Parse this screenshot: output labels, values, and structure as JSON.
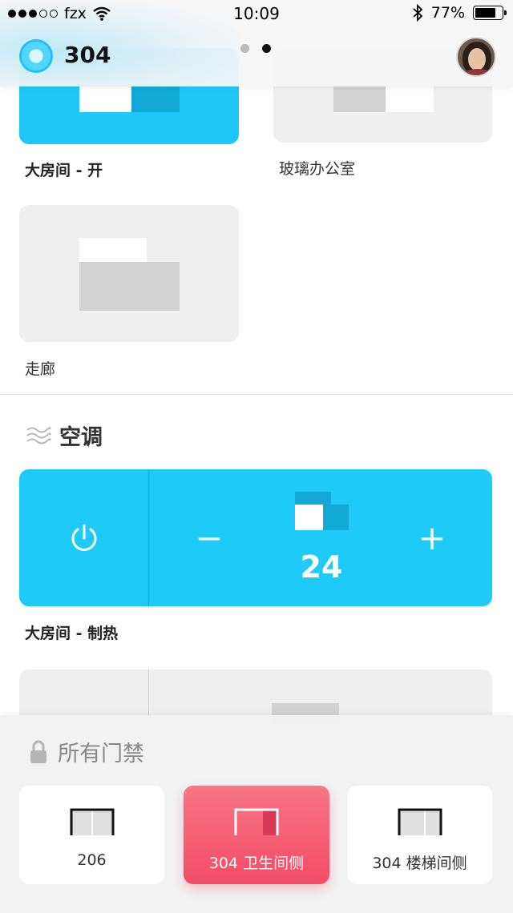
{
  "status_bar": {
    "carrier": "fzx",
    "time": "10:09",
    "battery": "77%",
    "battery_level": 0.77
  },
  "header": {
    "title": "304",
    "page_count": 2,
    "active_page": 2
  },
  "lights": [
    {
      "label": "大房间 - 开",
      "state": "on"
    },
    {
      "label": "玻璃办公室",
      "state": "off"
    },
    {
      "label": "走廊",
      "state": "off"
    }
  ],
  "ac_section": {
    "title": "空调",
    "units": [
      {
        "label": "大房间 - 制热",
        "temperature": "24",
        "state": "on",
        "minus": "−",
        "plus": "+"
      }
    ]
  },
  "door_panel": {
    "title": "所有门禁",
    "doors": [
      {
        "label": "206",
        "active": false
      },
      {
        "label": "304 卫生间侧",
        "active": true
      },
      {
        "label": "304 楼梯间侧",
        "active": false
      }
    ]
  },
  "colors": {
    "accent": "#1ec7f6",
    "door_active": "#f24b65",
    "card_off": "#efefef"
  }
}
